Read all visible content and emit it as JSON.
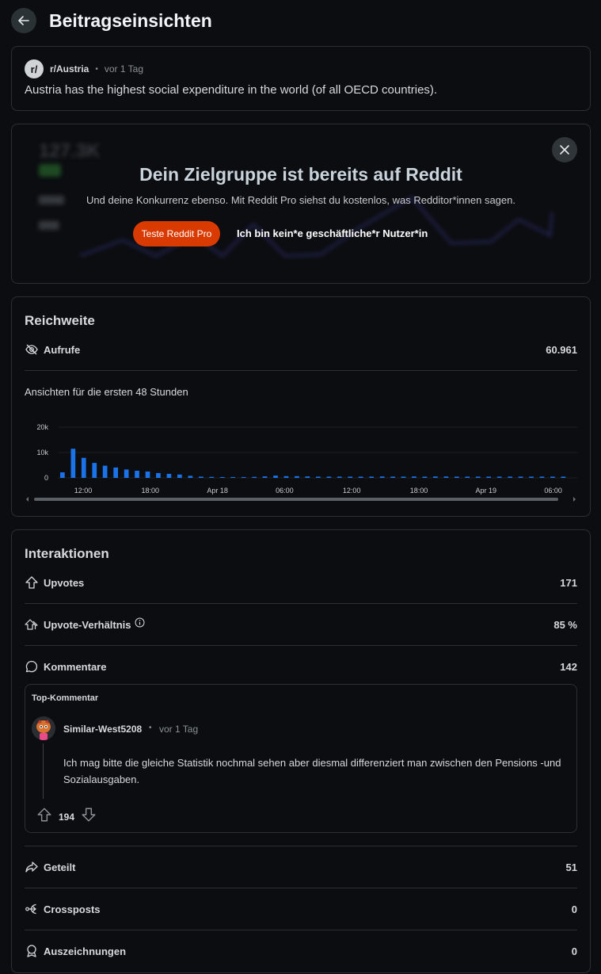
{
  "header": {
    "title": "Beitragseinsichten"
  },
  "post": {
    "subreddit": "r/Austria",
    "avatar_text": "r/",
    "time": "vor 1 Tag",
    "title": "Austria has the highest social expenditure in the world (of all OECD countries)."
  },
  "promo": {
    "background_number": "127.3K",
    "heading": "Dein Zielgruppe ist bereits auf Reddit",
    "subtext": "Und deine Konkurrenz ebenso. Mit Reddit Pro siehst du kostenlos, was Redditor*innen sagen.",
    "cta_label": "Teste Reddit Pro",
    "secondary_label": "Ich bin kein*e geschäftliche*r Nutzer*in"
  },
  "reach": {
    "title": "Reichweite",
    "views_label": "Aufrufe",
    "views_value": "60.961",
    "chart_caption": "Ansichten für die ersten 48 Stunden"
  },
  "chart_data": {
    "type": "bar",
    "y_ticks": [
      "20k",
      "10k",
      "0"
    ],
    "ylim": [
      0,
      20000
    ],
    "x_tick_labels": [
      "12:00",
      "18:00",
      "Apr 18",
      "06:00",
      "12:00",
      "18:00",
      "Apr 19",
      "06:00"
    ],
    "values": [
      2200,
      11500,
      7900,
      5900,
      4800,
      4100,
      3300,
      2800,
      2500,
      1900,
      1600,
      1300,
      800,
      500,
      400,
      350,
      350,
      350,
      400,
      600,
      900,
      700,
      700,
      600,
      500,
      500,
      500,
      500,
      500,
      500,
      550,
      500,
      500,
      550,
      500,
      550,
      550,
      500,
      500,
      500,
      500,
      500,
      500,
      500,
      500,
      500,
      500,
      500
    ],
    "bar_color": "#1a73e8"
  },
  "interactions": {
    "title": "Interaktionen",
    "upvotes_label": "Upvotes",
    "upvotes_value": "171",
    "ratio_label": "Upvote-Verhältnis",
    "ratio_value": "85 %",
    "comments_label": "Kommentare",
    "comments_value": "142",
    "shared_label": "Geteilt",
    "shared_value": "51",
    "crossposts_label": "Crossposts",
    "crossposts_value": "0",
    "awards_label": "Auszeichnungen",
    "awards_value": "0"
  },
  "top_comment": {
    "label": "Top-Kommentar",
    "username": "Similar-West5208",
    "time": "vor 1 Tag",
    "text": "Ich mag bitte die gleiche Statistik nochmal sehen aber diesmal differenziert man zwischen den Pensions -und Sozialausgaben.",
    "score": "194"
  }
}
